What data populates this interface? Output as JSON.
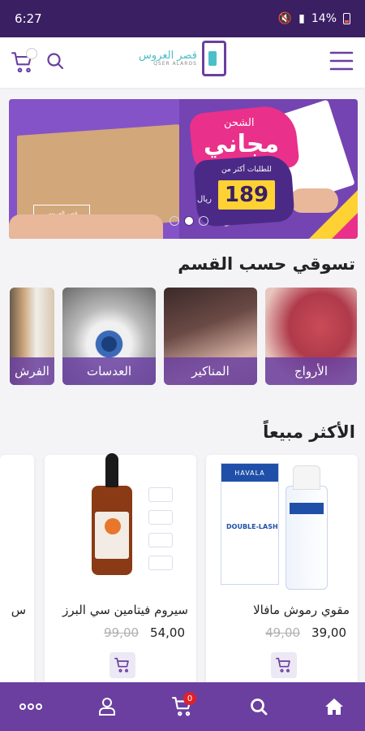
{
  "status_bar": {
    "time": "6:27",
    "battery": "14%"
  },
  "header": {
    "logo_ar": "قصر العروس",
    "logo_en": "QSER ALAROS",
    "icons": [
      "menu-icon",
      "logo",
      "search-icon",
      "cart-icon"
    ]
  },
  "banner": {
    "shipping_label": "الشحن",
    "free_label": "مجاني",
    "orders_label": "للطلبات أكثر من",
    "price": "189",
    "currency": "ريال",
    "box_label": "قصر العروس",
    "slide_index": 2,
    "slide_count": 3
  },
  "categories": {
    "title": "تسوقي حسب القسم",
    "items": [
      {
        "label": "الأرواج"
      },
      {
        "label": "المناكير"
      },
      {
        "label": "العدسات"
      },
      {
        "label": "الفرش"
      }
    ]
  },
  "best_sellers": {
    "title": "الأكثر مبيعاً",
    "products": [
      {
        "name": "مقوي رموش مافالا",
        "price": "39,00",
        "old_price": "49,00",
        "brand_text": "HAVALA",
        "product_text": "DOUBLE-LASH"
      },
      {
        "name": "سيروم فيتامين سي البرز",
        "price": "54,00",
        "old_price": "99,00"
      },
      {
        "name": "س"
      }
    ]
  },
  "bottom_nav": {
    "cart_count": "0",
    "items": [
      "home-icon",
      "search-icon",
      "cart-icon",
      "account-icon",
      "more-icon"
    ]
  },
  "colors": {
    "primary": "#6a3fa0",
    "status_bar": "#3a1f63",
    "accent_teal": "#4bbfc8",
    "badge_red": "#e0212b"
  }
}
